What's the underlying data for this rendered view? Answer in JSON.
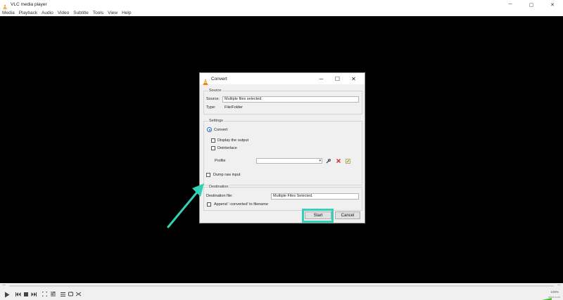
{
  "window": {
    "title": "VLC media player",
    "controls": {
      "minimize": "─",
      "maximize": "▢",
      "close": "✕"
    }
  },
  "menu": {
    "items": [
      "Media",
      "Playback",
      "Audio",
      "Video",
      "Subtitle",
      "Tools",
      "View",
      "Help"
    ]
  },
  "player": {
    "time_elapsed": "-:-",
    "time_total": "-:-",
    "volume_label": "100%",
    "watermark": "wtxd.com"
  },
  "dialog": {
    "title": "Convert",
    "controls": {
      "minimize": "─",
      "maximize": "☐",
      "close": "✕"
    },
    "source": {
      "group_title": "Source",
      "source_label": "Source:",
      "source_value": "Multiple files selected.",
      "type_label": "Type:",
      "type_value": "File/Folder"
    },
    "settings": {
      "group_title": "Settings",
      "convert_label": "Convert",
      "display_output_label": "Display the output",
      "deinterlace_label": "Deinterlace",
      "profile_label": "Profile",
      "profile_value": ""
    },
    "dump_raw_label": "Dump raw input",
    "destination": {
      "group_title": "Destination",
      "dest_file_label": "Destination file:",
      "dest_file_value": "Multiple Files Selected.",
      "append_label": "Append '-converted' to filename"
    },
    "buttons": {
      "start": "Start",
      "cancel": "Cancel"
    }
  },
  "colors": {
    "accent": "#33d1b6",
    "radio": "#1a66c4",
    "delete": "#d8262a",
    "vlc_orange": "#f08a00"
  }
}
